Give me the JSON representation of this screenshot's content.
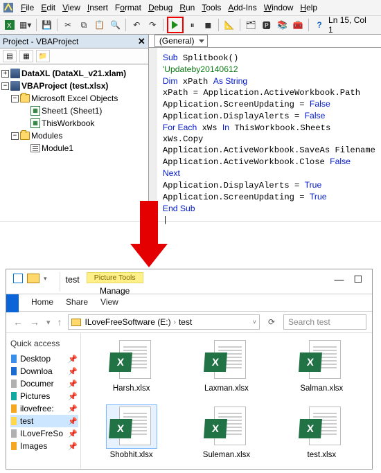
{
  "vba": {
    "menus": [
      "File",
      "Edit",
      "View",
      "Insert",
      "Format",
      "Debug",
      "Run",
      "Tools",
      "Add-Ins",
      "Window",
      "Help"
    ],
    "status": "Ln 15, Col 1",
    "project_title": "Project - VBAProject",
    "tree": {
      "p1": "DataXL (DataXL_v21.xlam)",
      "p2": "VBAProject (test.xlsx)",
      "grp1": "Microsoft Excel Objects",
      "s1": "Sheet1 (Sheet1)",
      "s2": "ThisWorkbook",
      "grp2": "Modules",
      "m1": "Module1"
    },
    "dropdown": "(General)",
    "code_lines": [
      {
        "t": "Sub Splitbook()",
        "c": "kw_sub"
      },
      {
        "t": "'Updateby20140612",
        "c": "cm"
      },
      {
        "t": "Dim xPath As String",
        "c": "kw_dim"
      },
      {
        "t": "xPath = Application.ActiveWorkbook.Path",
        "c": ""
      },
      {
        "t": "Application.ScreenUpdating = False",
        "c": "kw_false"
      },
      {
        "t": "Application.DisplayAlerts = False",
        "c": "kw_false"
      },
      {
        "t": "For Each xWs In ThisWorkbook.Sheets",
        "c": "kw_for"
      },
      {
        "t": "xWs.Copy",
        "c": ""
      },
      {
        "t": "Application.ActiveWorkbook.SaveAs Filename",
        "c": ""
      },
      {
        "t": "Application.ActiveWorkbook.Close False",
        "c": "kw_close"
      },
      {
        "t": "Next",
        "c": "kw"
      },
      {
        "t": "Application.DisplayAlerts = True",
        "c": "kw_true"
      },
      {
        "t": "Application.ScreenUpdating = True",
        "c": "kw_true"
      },
      {
        "t": "End Sub",
        "c": "kw"
      }
    ]
  },
  "explorer": {
    "folder_title": "test",
    "picture_tools": "Picture Tools",
    "manage": "Manage",
    "tabs": [
      "Home",
      "Share",
      "View"
    ],
    "drive": "ILoveFreeSoftware (E:)",
    "crumb2": "test",
    "search_placeholder": "Search test",
    "quick_access": "Quick access",
    "side": [
      {
        "label": "Desktop",
        "color": "c-blue"
      },
      {
        "label": "Downloa",
        "color": "c-dblue"
      },
      {
        "label": "Documer",
        "color": "c-gray"
      },
      {
        "label": "Pictures",
        "color": "c-teal"
      },
      {
        "label": "ilovefree:",
        "color": "c-orange"
      },
      {
        "label": "test",
        "color": "c-yell",
        "sel": true
      },
      {
        "label": "ILoveFreSo",
        "color": "c-gray"
      },
      {
        "label": "Images",
        "color": "c-orange"
      }
    ],
    "files": [
      "Harsh.xlsx",
      "Laxman.xlsx",
      "Salman.xlsx",
      "Shobhit.xlsx",
      "Suleman.xlsx",
      "test.xlsx"
    ],
    "selected_file": "Shobhit.xlsx"
  }
}
